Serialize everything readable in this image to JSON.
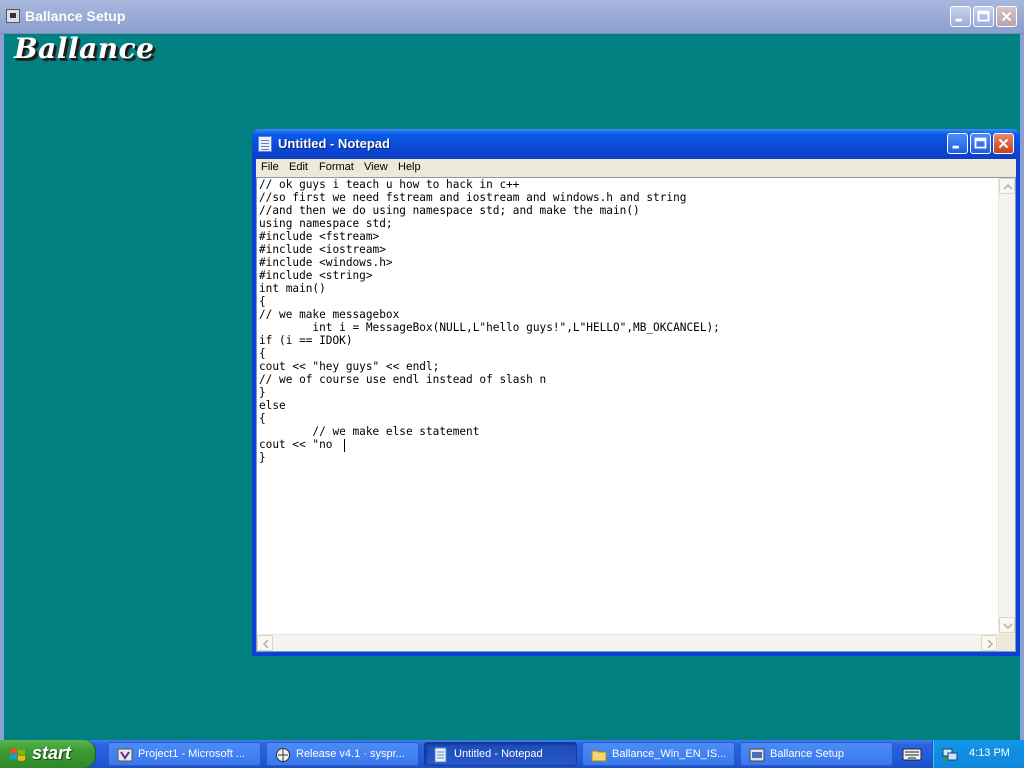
{
  "setup_window": {
    "title": "Ballance Setup",
    "logo_text": "Ballance"
  },
  "notepad": {
    "title": "Untitled - Notepad",
    "menu": [
      "File",
      "Edit",
      "Format",
      "View",
      "Help"
    ],
    "content": "// ok guys i teach u how to hack in c++\n//so first we need fstream and iostream and windows.h and string\n//and then we do using namespace std; and make the main()\nusing namespace std;\n#include <fstream>\n#include <iostream>\n#include <windows.h>\n#include <string>\nint main()\n{\n// we make messagebox\n        int i = MessageBox(NULL,L\"hello guys!\",L\"HELLO\",MB_OKCANCEL);\nif (i == IDOK)\n{\ncout << \"hey guys\" << endl;\n// we of course use endl instead of slash n\n}\nelse\n{\n        // we make else statement\ncout << \"no\n}"
  },
  "taskbar": {
    "start_label": "start",
    "tasks": [
      {
        "label": "Project1 - Microsoft ...",
        "icon": "visual-studio-icon",
        "active": false
      },
      {
        "label": "Release v4.1 · syspr...",
        "icon": "browser-icon",
        "active": false
      },
      {
        "label": "Untitled - Notepad",
        "icon": "notepad-icon",
        "active": true
      },
      {
        "label": "Ballance_Win_EN_IS...",
        "icon": "folder-icon",
        "active": false
      },
      {
        "label": "Ballance Setup",
        "icon": "setup-icon",
        "active": false
      }
    ],
    "clock": "4:13 PM"
  },
  "colors": {
    "desktop": "#008080",
    "xp_title_blue": "#0a49d8",
    "taskbar_blue": "#245ddb",
    "start_green": "#3c9a34",
    "tray_blue": "#0f8fe2"
  }
}
